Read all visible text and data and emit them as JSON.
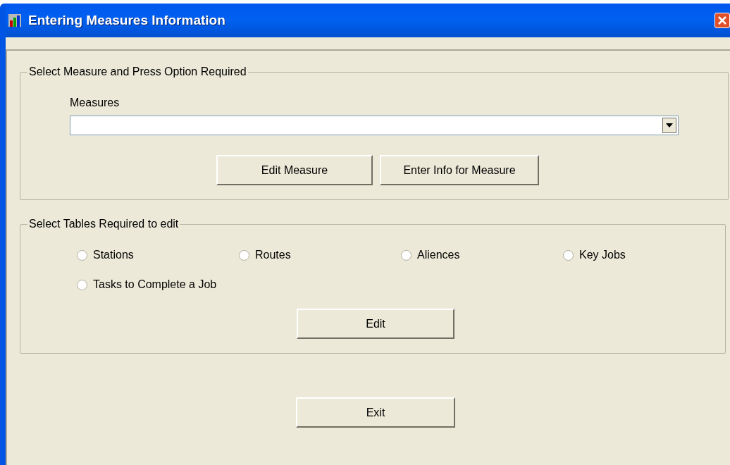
{
  "window": {
    "title": "Entering Measures Information"
  },
  "measure_group": {
    "title": "Select Measure and Press Option Required",
    "combo_label": "Measures",
    "buttons": [
      "Edit Measure",
      "Enter Info for Measure"
    ]
  },
  "tables_group": {
    "title": "Select Tables Required to edit",
    "options": [
      {
        "label": "Stations",
        "selected": false
      },
      {
        "label": "Routes",
        "selected": false
      },
      {
        "label": "Aliences",
        "selected": false
      },
      {
        "label": "Key Jobs",
        "selected": false
      },
      {
        "label": "Tasks to Complete a Job",
        "selected": false
      }
    ],
    "button": "Edit"
  },
  "exit_button": "Exit"
}
